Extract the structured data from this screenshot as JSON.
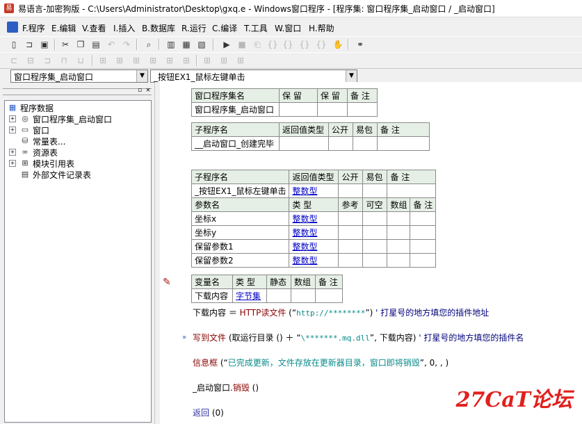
{
  "window": {
    "title": "易语言-加密狗版 - C:\\Users\\Administrator\\Desktop\\gxq.e - Windows窗口程序 - [程序集: 窗口程序集_启动窗口 / _启动窗口]"
  },
  "menu": {
    "items": [
      "F.程序",
      "E.编辑",
      "V.查看",
      "I.插入",
      "B.数据库",
      "R.运行",
      "C.编译",
      "T.工具",
      "W.窗口",
      "H.帮助"
    ]
  },
  "selectors": {
    "assembly": "窗口程序集_启动窗口",
    "subroutine": "_按钮EX1_鼠标左键单击"
  },
  "tree": {
    "root": "程序数据",
    "items": [
      "窗口程序集_启动窗口",
      "窗口",
      "常量表...",
      "资源表",
      "模块引用表",
      "外部文件记录表"
    ]
  },
  "assembly_table": {
    "headers": [
      "窗口程序集名",
      "保 留",
      "保 留",
      "备 注"
    ],
    "row": [
      "窗口程序集_启动窗口",
      "",
      "",
      ""
    ]
  },
  "sub1_table": {
    "headers": [
      "子程序名",
      "返回值类型",
      "公开",
      "易包",
      "备 注"
    ],
    "row": [
      "__启动窗口_创建完毕",
      "",
      "",
      "",
      ""
    ]
  },
  "sub2_table": {
    "headers": [
      "子程序名",
      "返回值类型",
      "公开",
      "易包",
      "备 注"
    ],
    "row": [
      "_按钮EX1_鼠标左键单击",
      "整数型",
      "",
      "",
      ""
    ],
    "param_headers": [
      "参数名",
      "类 型",
      "参考",
      "可空",
      "数组",
      "备 注"
    ],
    "params": [
      [
        "坐标x",
        "整数型"
      ],
      [
        "坐标y",
        "整数型"
      ],
      [
        "保留参数1",
        "整数型"
      ],
      [
        "保留参数2",
        "整数型"
      ]
    ]
  },
  "var_table": {
    "headers": [
      "变量名",
      "类 型",
      "静态",
      "数组",
      "备 注"
    ],
    "row": [
      "下载内容",
      "字节集",
      "",
      "",
      ""
    ]
  },
  "code": {
    "line1": {
      "a": "下载内容 ＝ ",
      "b": "HTTP读文件",
      "c": " (“",
      "d": "http://********",
      "e": "”)",
      "f": "  ' 打星号的地方填您的插件地址"
    },
    "line2": {
      "a": "写到文件",
      "b": " (取运行目录 () ＋ “",
      "c": "\\*******.mq.dll",
      "d": "”, 下载内容)",
      "e": "  ' 打星号的地方填您的插件名"
    },
    "line3": {
      "a": "信息框",
      "b": " (“",
      "c": "已完成更新，文件存放在更新器目录，窗口即将销毁",
      "d": "”, 0, , )"
    },
    "line4": {
      "a": "_启动窗口.",
      "b": "销毁",
      "c": " ()"
    },
    "line5": {
      "a": "返回",
      "b": " (0)"
    }
  },
  "watermark": "27CaT论坛"
}
